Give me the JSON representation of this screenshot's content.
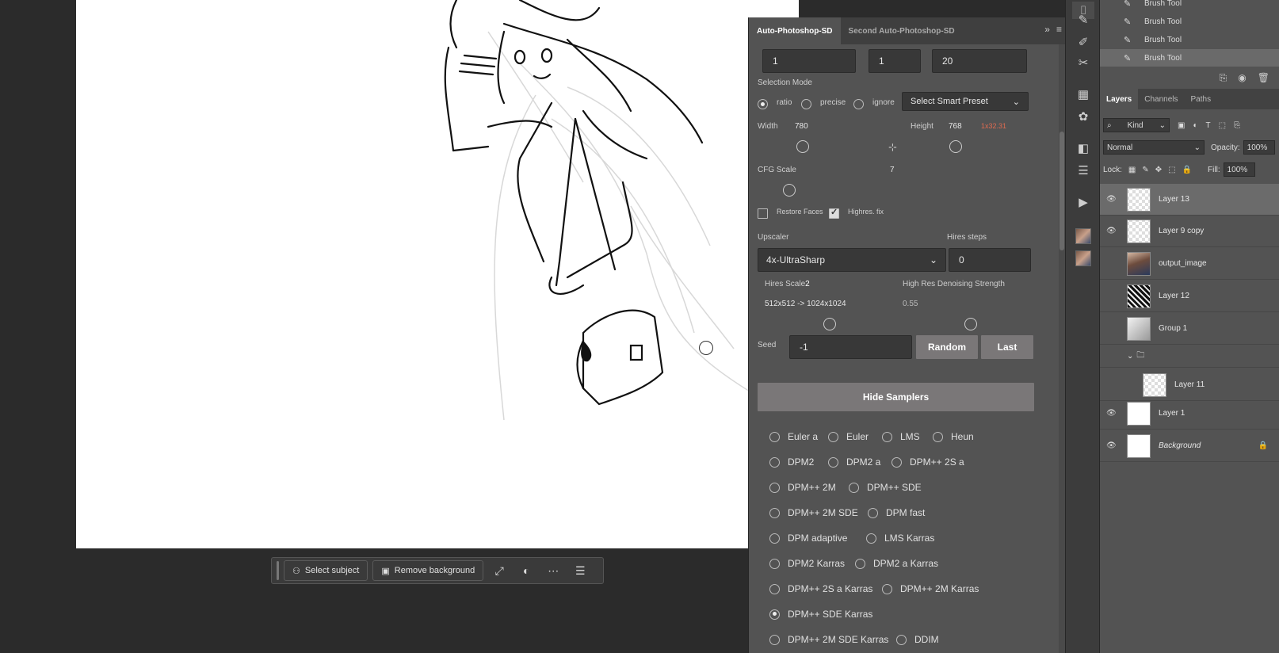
{
  "context_bar": {
    "select_subject": "Select subject",
    "remove_background": "Remove background"
  },
  "plugin": {
    "tabs": [
      "Auto-Photoshop-SD",
      "Second Auto-Photoshop-SD"
    ],
    "batch_fields": [
      "1",
      "1",
      "20"
    ],
    "selection_mode_label": "Selection Mode",
    "selection_modes": [
      {
        "label": "ratio",
        "selected": true
      },
      {
        "label": "precise",
        "selected": false
      },
      {
        "label": "ignore",
        "selected": false
      }
    ],
    "smart_preset": "Select Smart Preset",
    "width_label": "Width",
    "width_value": "780",
    "height_label": "Height",
    "height_value": "768",
    "height_hint": "1x32.31",
    "cfg_label": "CFG Scale",
    "cfg_value": "7",
    "restore_faces": "Restore Faces",
    "highres_fix": "Highres. fix",
    "upscaler_label": "Upscaler",
    "upscaler_value": "4x-UltraSharp",
    "hires_steps_label": "Hires steps",
    "hires_steps_value": "0",
    "hires_scale_label": "Hires Scale",
    "hires_scale_value": "2",
    "hires_resolution": "512x512 -> 1024x1024",
    "denoise_label": "High Res Denoising Strength",
    "denoise_value": "0.55",
    "seed_label": "Seed",
    "seed_value": "-1",
    "random_button": "Random",
    "last_button": "Last",
    "hide_samplers": "Hide Samplers",
    "samplers": [
      [
        "Euler a",
        "Euler",
        "LMS",
        "Heun"
      ],
      [
        "DPM2",
        "DPM2 a",
        "DPM++ 2S a"
      ],
      [
        "DPM++ 2M",
        "DPM++ SDE"
      ],
      [
        "DPM++ 2M SDE",
        "DPM fast"
      ],
      [
        "DPM adaptive",
        "LMS Karras"
      ],
      [
        "DPM2 Karras",
        "DPM2 a Karras"
      ],
      [
        "DPM++ 2S a Karras",
        "DPM++ 2M Karras"
      ],
      [
        "DPM++ SDE Karras"
      ],
      [
        "DPM++ 2M SDE Karras",
        "DDIM"
      ]
    ],
    "selected_sampler": "DPM++ SDE Karras"
  },
  "history": {
    "items": [
      "Brush Tool",
      "Brush Tool",
      "Brush Tool",
      "Brush Tool"
    ]
  },
  "layers_panel": {
    "tabs": [
      "Layers",
      "Channels",
      "Paths"
    ],
    "kind": "Kind",
    "blend_mode": "Normal",
    "opacity_label": "Opacity:",
    "opacity_value": "100%",
    "lock_label": "Lock:",
    "fill_label": "Fill:",
    "fill_value": "100%",
    "layers": [
      {
        "name": "Layer 13",
        "visible": true,
        "selected": true
      },
      {
        "name": "Layer 9 copy",
        "visible": true,
        "selected": false
      },
      {
        "name": "output_image",
        "visible": false,
        "selected": false
      },
      {
        "name": "Layer 12",
        "visible": false,
        "selected": false
      },
      {
        "name": "Group 1",
        "visible": false,
        "selected": false
      },
      {
        "name": "Layer 11",
        "visible": false,
        "selected": false
      },
      {
        "name": "Layer 1",
        "visible": true,
        "selected": false
      },
      {
        "name": "Background",
        "visible": true,
        "selected": false
      }
    ]
  }
}
